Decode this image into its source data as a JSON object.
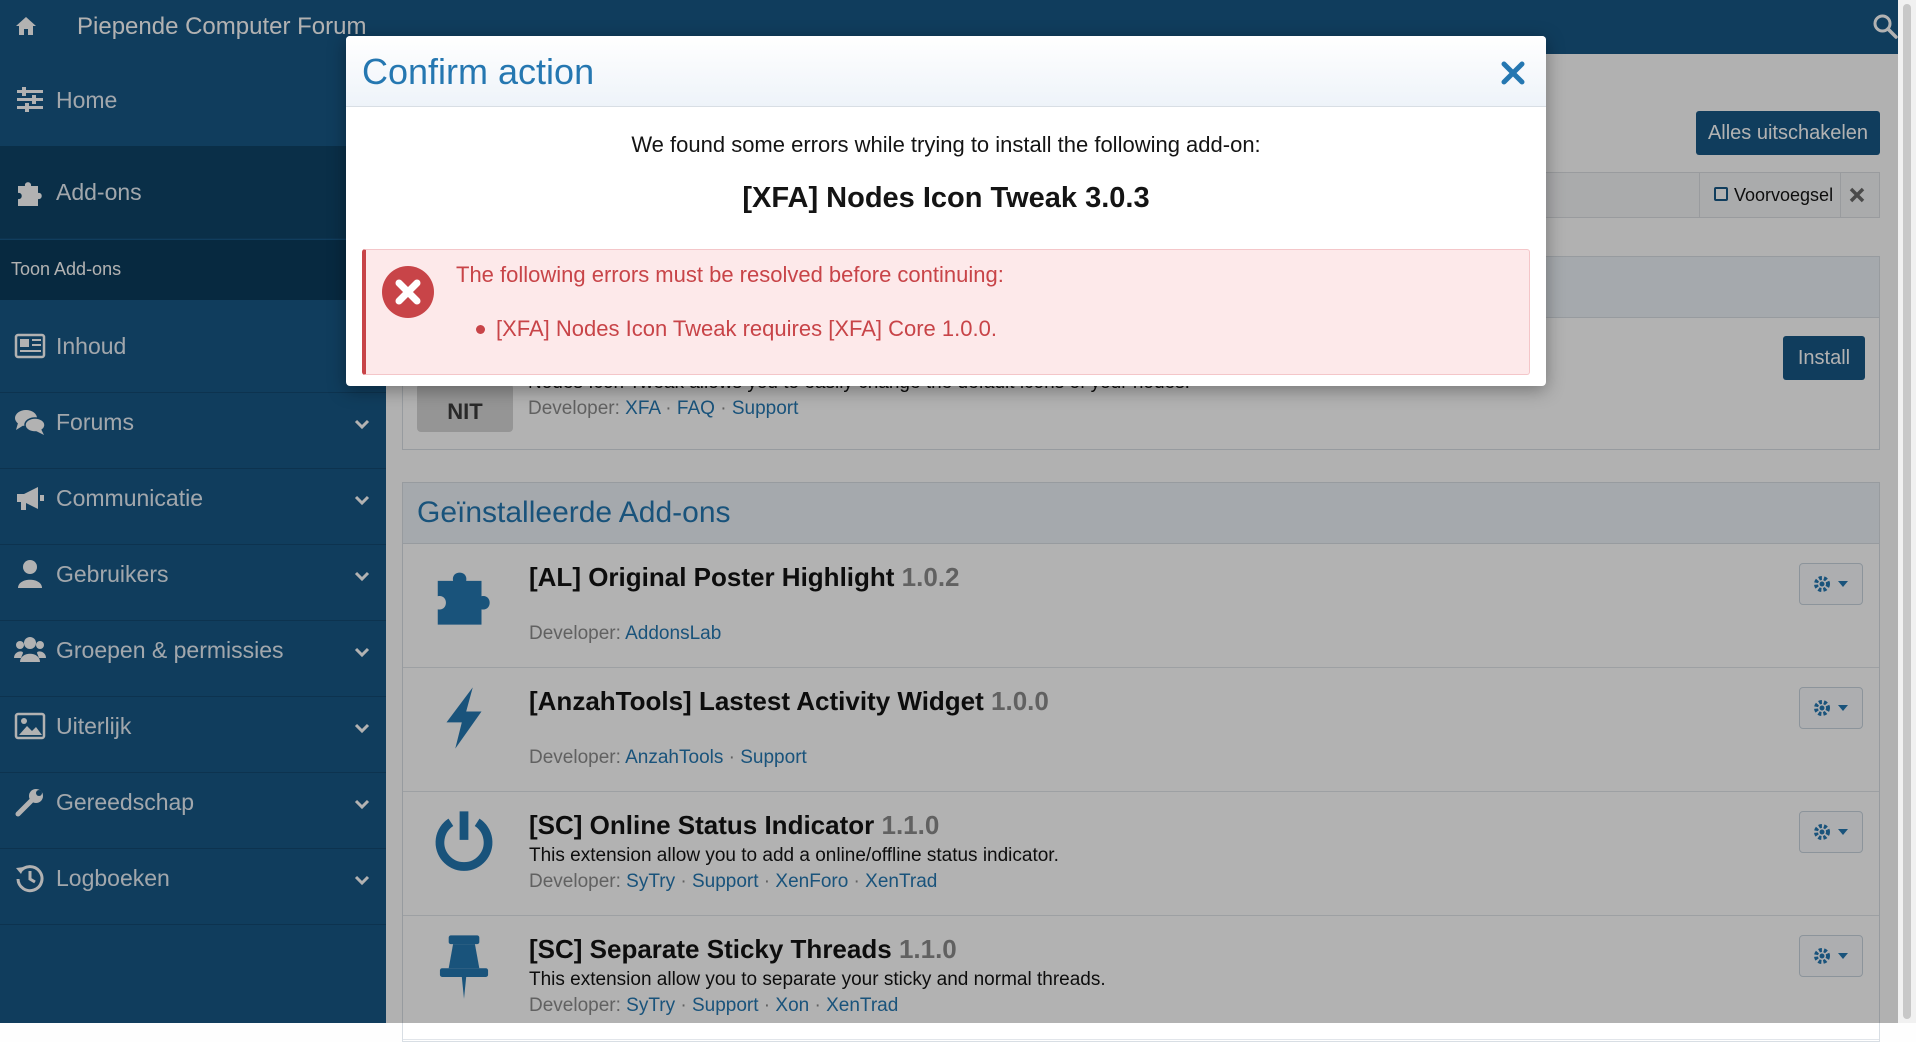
{
  "topbar": {
    "title": "Piepende Computer Forum",
    "home_icon": "home-icon",
    "search_icon": "search-icon"
  },
  "sidebar": {
    "items": [
      {
        "label": "Home",
        "icon": "sliders-icon"
      },
      {
        "label": "Add-ons",
        "icon": "puzzle-icon"
      },
      {
        "label": "Inhoud",
        "icon": "newspaper-icon"
      },
      {
        "label": "Forums",
        "icon": "comments-icon"
      },
      {
        "label": "Communicatie",
        "icon": "bullhorn-icon"
      },
      {
        "label": "Gebruikers",
        "icon": "user-icon"
      },
      {
        "label": "Groepen & permissies",
        "icon": "users-icon"
      },
      {
        "label": "Uiterlijk",
        "icon": "image-icon"
      },
      {
        "label": "Gereedschap",
        "icon": "wrench-icon"
      },
      {
        "label": "Logboeken",
        "icon": "history-icon"
      }
    ],
    "sub_item": "Toon Add-ons"
  },
  "main": {
    "disable_all_label": "Alles uitschakelen",
    "filter_prefix_label": "Voorvoegsel",
    "install_label": "Install",
    "pending_addon": {
      "badge": "NIT",
      "description": "Nodes Icon Tweak allows you to easily change the default icons of your nodes.",
      "developer_label": "Developer:",
      "links": [
        "XFA",
        "FAQ",
        "Support"
      ]
    },
    "installed_title": "Geïnstalleerde Add-ons",
    "installed": [
      {
        "title": "[AL] Original Poster Highlight",
        "version": "1.0.2",
        "description": "",
        "developer_label": "Developer:",
        "links": [
          "AddonsLab"
        ],
        "icon": "puzzle-icon"
      },
      {
        "title": "[AnzahTools] Lastest Activity Widget",
        "version": "1.0.0",
        "description": "",
        "developer_label": "Developer:",
        "links": [
          "AnzahTools",
          "Support"
        ],
        "icon": "bolt-icon"
      },
      {
        "title": "[SC] Online Status Indicator",
        "version": "1.1.0",
        "description": "This extension allow you to add a online/offline status indicator.",
        "developer_label": "Developer:",
        "links": [
          "SyTry",
          "Support",
          "XenForo",
          "XenTrad"
        ],
        "icon": "power-icon"
      },
      {
        "title": "[SC] Separate Sticky Threads",
        "version": "1.1.0",
        "description": "This extension allow you to separate your sticky and normal threads.",
        "developer_label": "Developer:",
        "links": [
          "SyTry",
          "Support",
          "Xon",
          "XenTrad"
        ],
        "icon": "thumbtack-icon"
      }
    ]
  },
  "modal": {
    "title": "Confirm action",
    "message": "We found some errors while trying to install the following add-on:",
    "addon_name": "[XFA] Nodes Icon Tweak 3.0.3",
    "error_heading": "The following errors must be resolved before continuing:",
    "errors": [
      "[XFA] Nodes Icon Tweak requires [XFA] Core 1.0.0."
    ]
  },
  "colors": {
    "brand": "#185886",
    "link": "#2577b1",
    "error": "#c84448",
    "error_bg": "#fde9ea"
  }
}
